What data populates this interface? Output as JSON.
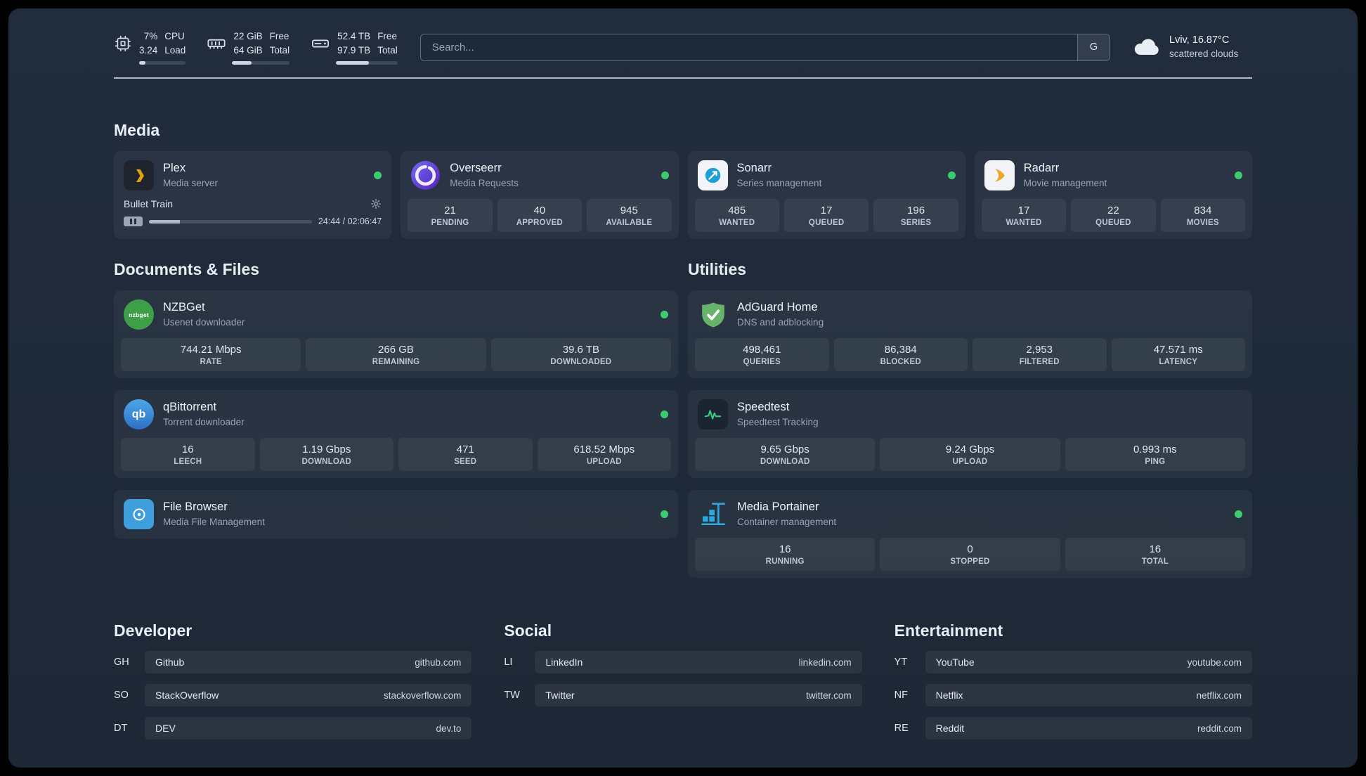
{
  "header": {
    "cpu": {
      "percent": "7%",
      "load": "3.24",
      "label_top": "CPU",
      "label_bottom": "Load",
      "bar_percent": 13
    },
    "memory": {
      "free": "22 GiB",
      "total": "64 GiB",
      "label_top": "Free",
      "label_bottom": "Total",
      "bar_percent": 34
    },
    "disk": {
      "free": "52.4 TB",
      "total": "97.9 TB",
      "label_top": "Free",
      "label_bottom": "Total",
      "bar_percent": 53
    },
    "search": {
      "placeholder": "Search...",
      "provider": "G"
    },
    "weather": {
      "location": "Lviv, 16.87°C",
      "condition": "scattered clouds"
    }
  },
  "media": {
    "title": "Media",
    "plex": {
      "name": "Plex",
      "subtitle": "Media server",
      "now_playing": "Bullet Train",
      "time": "24:44 / 02:06:47",
      "progress_percent": 19
    },
    "overseerr": {
      "name": "Overseerr",
      "subtitle": "Media Requests",
      "stats": [
        {
          "value": "21",
          "label": "PENDING"
        },
        {
          "value": "40",
          "label": "APPROVED"
        },
        {
          "value": "945",
          "label": "AVAILABLE"
        }
      ]
    },
    "sonarr": {
      "name": "Sonarr",
      "subtitle": "Series management",
      "stats": [
        {
          "value": "485",
          "label": "WANTED"
        },
        {
          "value": "17",
          "label": "QUEUED"
        },
        {
          "value": "196",
          "label": "SERIES"
        }
      ]
    },
    "radarr": {
      "name": "Radarr",
      "subtitle": "Movie management",
      "stats": [
        {
          "value": "17",
          "label": "WANTED"
        },
        {
          "value": "22",
          "label": "QUEUED"
        },
        {
          "value": "834",
          "label": "MOVIES"
        }
      ]
    }
  },
  "documents": {
    "title": "Documents & Files",
    "nzbget": {
      "name": "NZBGet",
      "subtitle": "Usenet downloader",
      "icon_text": "nzbget",
      "stats": [
        {
          "value": "744.21 Mbps",
          "label": "RATE"
        },
        {
          "value": "266 GB",
          "label": "REMAINING"
        },
        {
          "value": "39.6 TB",
          "label": "DOWNLOADED"
        }
      ]
    },
    "qbittorrent": {
      "name": "qBittorrent",
      "subtitle": "Torrent downloader",
      "icon_text": "qb",
      "stats": [
        {
          "value": "16",
          "label": "LEECH"
        },
        {
          "value": "1.19 Gbps",
          "label": "DOWNLOAD"
        },
        {
          "value": "471",
          "label": "SEED"
        },
        {
          "value": "618.52 Mbps",
          "label": "UPLOAD"
        }
      ]
    },
    "filebrowser": {
      "name": "File Browser",
      "subtitle": "Media File Management"
    }
  },
  "utilities": {
    "title": "Utilities",
    "adguard": {
      "name": "AdGuard Home",
      "subtitle": "DNS and adblocking",
      "stats": [
        {
          "value": "498,461",
          "label": "QUERIES"
        },
        {
          "value": "86,384",
          "label": "BLOCKED"
        },
        {
          "value": "2,953",
          "label": "FILTERED"
        },
        {
          "value": "47.571 ms",
          "label": "LATENCY"
        }
      ]
    },
    "speedtest": {
      "name": "Speedtest",
      "subtitle": "Speedtest Tracking",
      "stats": [
        {
          "value": "9.65 Gbps",
          "label": "DOWNLOAD"
        },
        {
          "value": "9.24 Gbps",
          "label": "UPLOAD"
        },
        {
          "value": "0.993 ms",
          "label": "PING"
        }
      ]
    },
    "portainer": {
      "name": "Media Portainer",
      "subtitle": "Container management",
      "stats": [
        {
          "value": "16",
          "label": "RUNNING"
        },
        {
          "value": "0",
          "label": "STOPPED"
        },
        {
          "value": "16",
          "label": "TOTAL"
        }
      ]
    }
  },
  "bookmarks": {
    "developer": {
      "title": "Developer",
      "links": [
        {
          "abbr": "GH",
          "name": "Github",
          "url": "github.com"
        },
        {
          "abbr": "SO",
          "name": "StackOverflow",
          "url": "stackoverflow.com"
        },
        {
          "abbr": "DT",
          "name": "DEV",
          "url": "dev.to"
        }
      ]
    },
    "social": {
      "title": "Social",
      "links": [
        {
          "abbr": "LI",
          "name": "LinkedIn",
          "url": "linkedin.com"
        },
        {
          "abbr": "TW",
          "name": "Twitter",
          "url": "twitter.com"
        }
      ]
    },
    "entertainment": {
      "title": "Entertainment",
      "links": [
        {
          "abbr": "YT",
          "name": "YouTube",
          "url": "youtube.com"
        },
        {
          "abbr": "NF",
          "name": "Netflix",
          "url": "netflix.com"
        },
        {
          "abbr": "RE",
          "name": "Reddit",
          "url": "reddit.com"
        }
      ]
    }
  }
}
